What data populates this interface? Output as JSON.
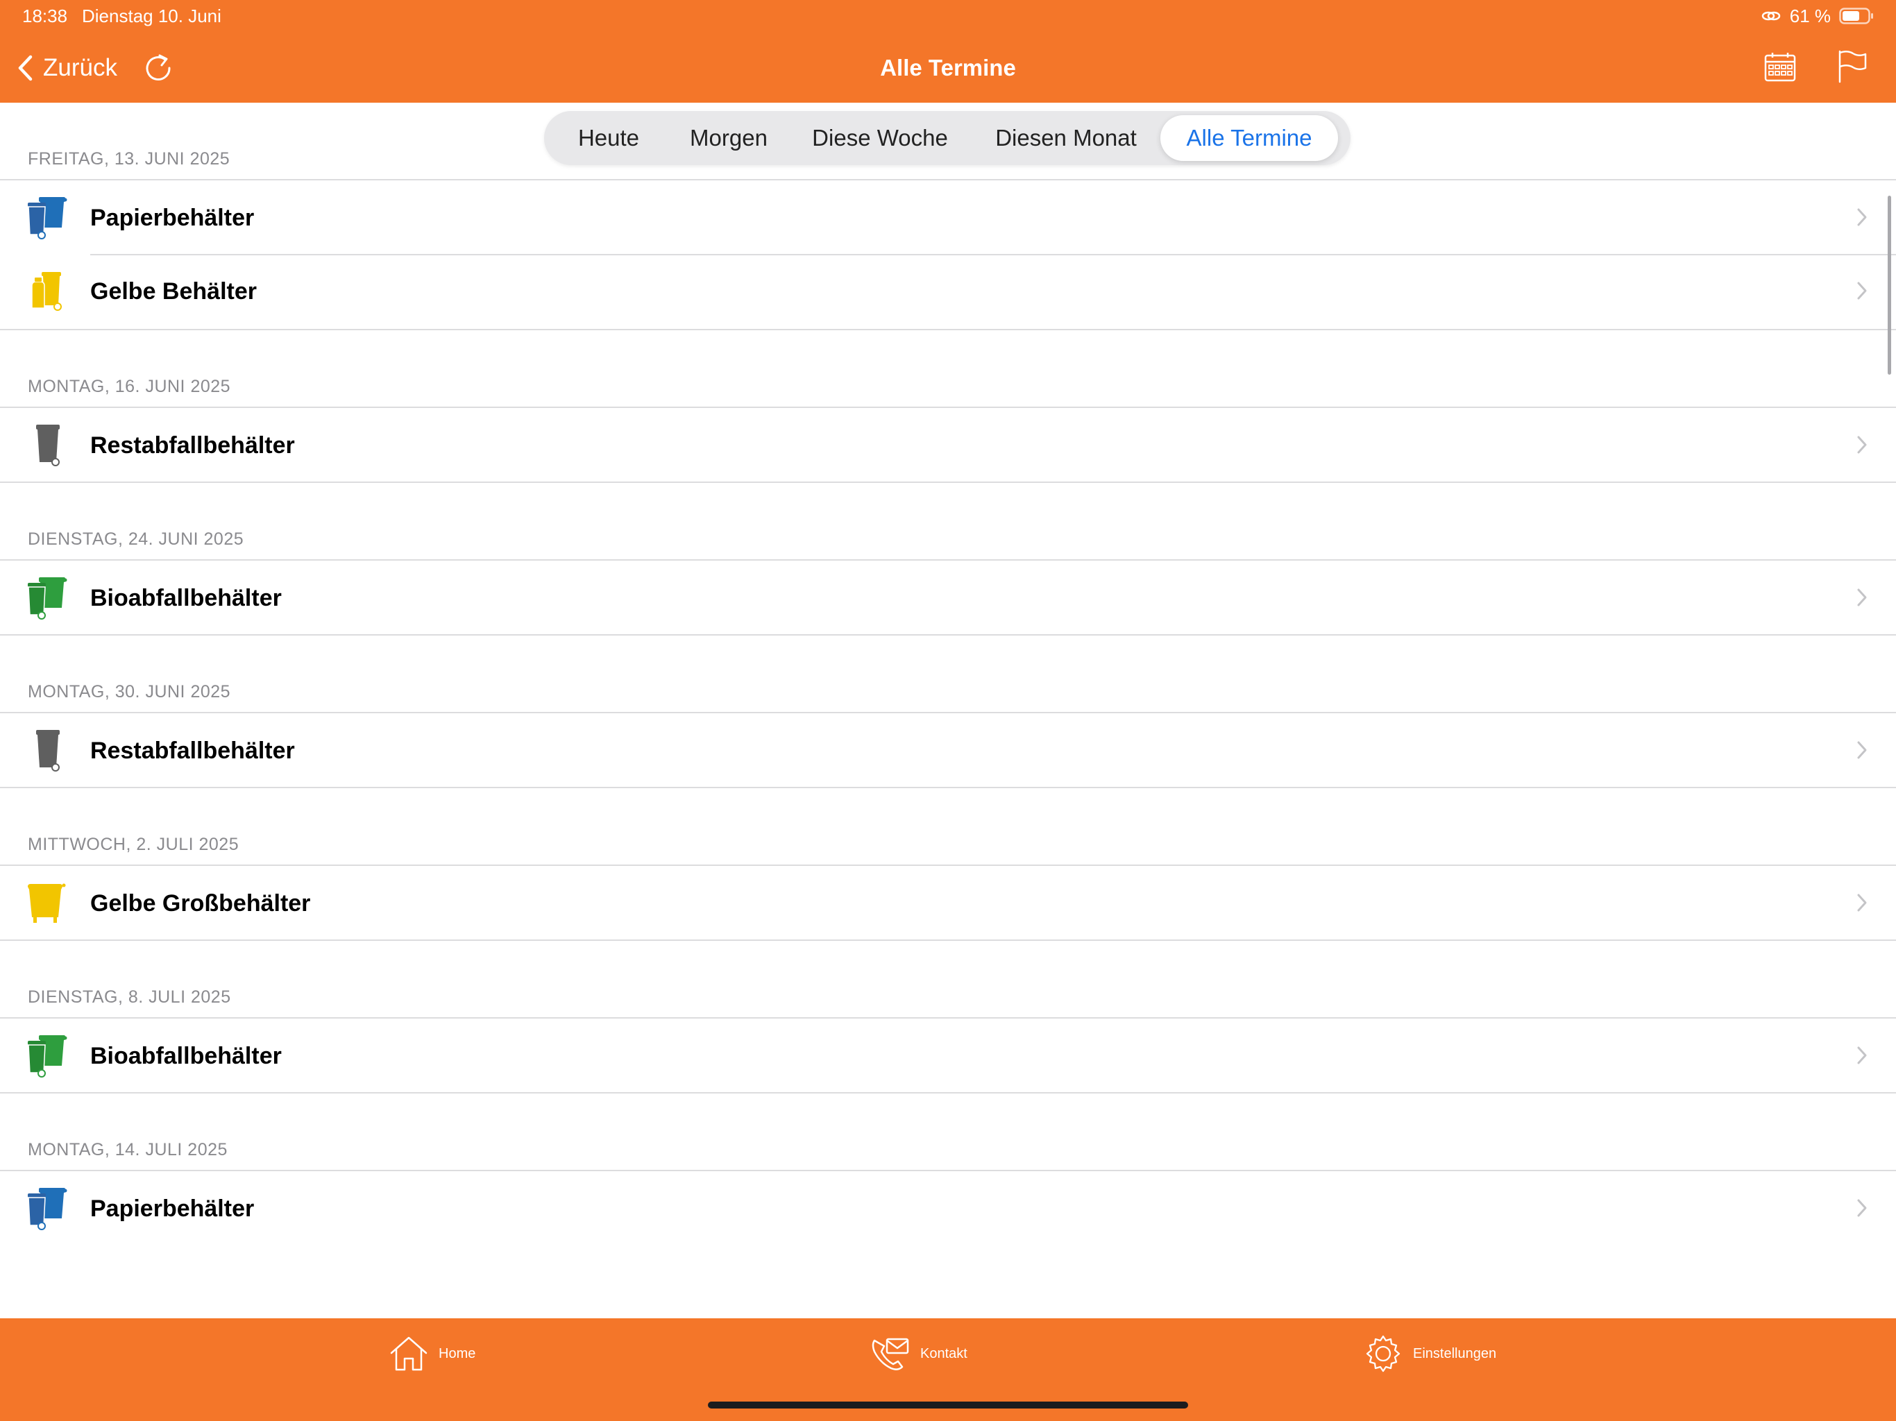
{
  "status_bar": {
    "time": "18:38",
    "date": "Dienstag 10. Juni",
    "battery": "61 %",
    "icons": [
      "link-icon",
      "battery-icon"
    ]
  },
  "nav_bar": {
    "back_label": "Zurück",
    "title": "Alle Termine",
    "icons": [
      "chevron-left-icon",
      "refresh-icon",
      "calendar-icon",
      "flag-icon"
    ]
  },
  "segments": {
    "items": [
      "Heute",
      "Morgen",
      "Diese Woche",
      "Diesen Monat",
      "Alle Termine"
    ],
    "selected": "Alle Termine"
  },
  "sections": [
    {
      "date": "FREITAG, 13. JUNI 2025",
      "items": [
        {
          "label": "Papierbehälter",
          "icon": "blue-bin-icon"
        },
        {
          "label": "Gelbe Behälter",
          "icon": "yellow-bin-icon"
        }
      ]
    },
    {
      "date": "MONTAG, 16. JUNI 2025",
      "items": [
        {
          "label": "Restabfallbehälter",
          "icon": "gray-bin-icon"
        }
      ]
    },
    {
      "date": "DIENSTAG, 24. JUNI 2025",
      "items": [
        {
          "label": "Bioabfallbehälter",
          "icon": "green-bin-icon"
        }
      ]
    },
    {
      "date": "MONTAG, 30. JUNI 2025",
      "items": [
        {
          "label": "Restabfallbehälter",
          "icon": "gray-bin-icon"
        }
      ]
    },
    {
      "date": "MITTWOCH, 2. JULI 2025",
      "items": [
        {
          "label": "Gelbe Großbehälter",
          "icon": "yellow-container-icon"
        }
      ]
    },
    {
      "date": "DIENSTAG, 8. JULI 2025",
      "items": [
        {
          "label": "Bioabfallbehälter",
          "icon": "green-bin-icon"
        }
      ]
    },
    {
      "date": "MONTAG, 14. JULI 2025",
      "items": [
        {
          "label": "Papierbehälter",
          "icon": "blue-bin-icon"
        }
      ]
    }
  ],
  "tab_bar": {
    "items": [
      {
        "label": "Home",
        "icon": "home-icon"
      },
      {
        "label": "Kontakt",
        "icon": "contact-icon"
      },
      {
        "label": "Einstellungen",
        "icon": "gear-icon"
      }
    ]
  },
  "colors": {
    "brand": "#f47629",
    "selected_segment": "#1a73e8",
    "paper_bin": "#1f6fb8",
    "yellow_bin": "#f2c500",
    "residual_bin": "#5f5f5f",
    "bio_bin": "#2e9e3e"
  }
}
